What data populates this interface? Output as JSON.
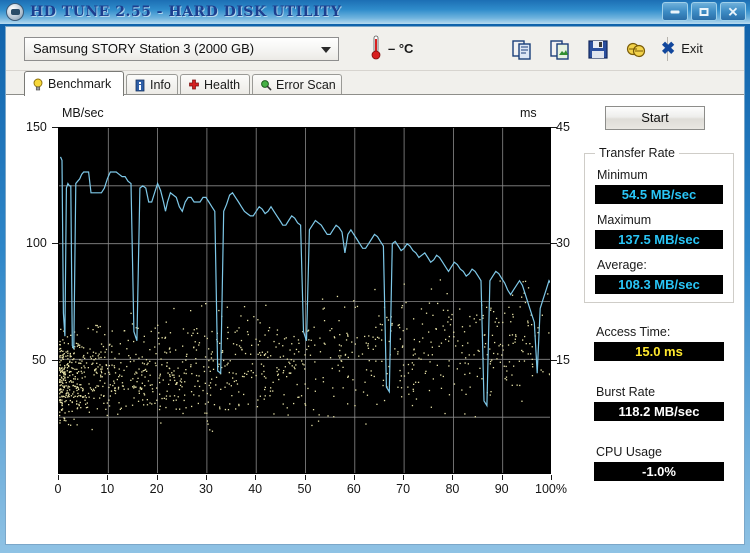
{
  "window": {
    "title": "HD TUNE 2.55 - HARD DISK UTILITY",
    "icon": "disk-icon",
    "minimize": "–",
    "maximize": "□",
    "close": "✕"
  },
  "toolbar": {
    "drive": "Samsung STORY Station 3 (2000 GB)",
    "temperature": "– °C",
    "thermometer_icon": "thermometer-icon",
    "icons": [
      {
        "name": "copy-icon"
      },
      {
        "name": "copy-image-icon"
      },
      {
        "name": "save-icon"
      },
      {
        "name": "globe-icon"
      }
    ],
    "exit_mark": "✖",
    "exit_label": "Exit"
  },
  "tabs": [
    {
      "label": "Benchmark",
      "icon": "bulb-icon",
      "active": true
    },
    {
      "label": "Info",
      "icon": "info-icon",
      "active": false
    },
    {
      "label": "Health",
      "icon": "health-cross-icon",
      "active": false
    },
    {
      "label": "Error Scan",
      "icon": "magnifier-icon",
      "active": false
    }
  ],
  "side": {
    "start_label": "Start",
    "transfer_rate_title": "Transfer Rate",
    "minimum_label": "Minimum",
    "minimum_value": "54.5 MB/sec",
    "maximum_label": "Maximum",
    "maximum_value": "137.5 MB/sec",
    "average_label": "Average:",
    "average_value": "108.3 MB/sec",
    "access_time_label": "Access Time:",
    "access_time_value": "15.0 ms",
    "burst_rate_label": "Burst Rate",
    "burst_rate_value": "118.2 MB/sec",
    "cpu_usage_label": "CPU Usage",
    "cpu_usage_value": "-1.0%"
  },
  "colors": {
    "transfer_curve": "#7ec8e8",
    "access_dots": "#e8e3a8",
    "value_cyan": "#29c5f6",
    "value_yellow": "#ffe82e",
    "title_blue": "#1c3f8f"
  },
  "chart_data": {
    "type": "line",
    "title": "",
    "ylabel": "MB/sec",
    "ylabel_right": "ms",
    "xlabel": "100%",
    "xlim": [
      0,
      100
    ],
    "ylim": [
      0,
      150
    ],
    "ylim_right": [
      0,
      45
    ],
    "grid": true,
    "xticks": [
      0,
      10,
      20,
      30,
      40,
      50,
      60,
      70,
      80,
      90,
      100
    ],
    "xticklabels": [
      "0",
      "10",
      "20",
      "30",
      "40",
      "50",
      "60",
      "70",
      "80",
      "90",
      "100%"
    ],
    "yticks": [
      50,
      100,
      150
    ],
    "yticklabels": [
      "50",
      "100",
      "150"
    ],
    "yticks_right": [
      15,
      30,
      45
    ],
    "yticklabels_right": [
      "15",
      "30",
      "45"
    ],
    "series": [
      {
        "name": "Transfer rate",
        "unit": "MB/sec",
        "color": "#7ec8e8",
        "x": [
          0.3,
          0.6,
          0.9,
          1.2,
          1.5,
          1.8,
          2.1,
          2.4,
          2.7,
          3.0,
          3.4,
          3.8,
          4.2,
          4.6,
          5.0,
          5.5,
          6.0,
          6.5,
          7.0,
          7.5,
          8.0,
          8.6,
          9.2,
          9.8,
          10.4,
          11.0,
          11.6,
          12.2,
          12.8,
          13.4,
          14.0,
          14.6,
          15.2,
          15.8,
          16.4,
          17.0,
          17.6,
          18.2,
          18.8,
          19.4,
          20.0,
          20.6,
          21.2,
          21.6,
          22.0,
          22.6,
          23.2,
          23.8,
          24.4,
          25.0,
          25.6,
          26.2,
          26.8,
          27.4,
          28.0,
          28.6,
          29.2,
          29.8,
          30.4,
          31.0,
          31.6,
          32.2,
          32.8,
          33.4,
          34.0,
          34.6,
          35.2,
          35.8,
          36.4,
          37.0,
          37.6,
          38.2,
          38.8,
          39.4,
          40.0,
          40.6,
          41.2,
          41.8,
          42.4,
          43.0,
          43.6,
          44.2,
          44.8,
          45.4,
          46.0,
          46.6,
          47.2,
          47.8,
          48.4,
          49.0,
          49.6,
          50.2,
          50.8,
          51.4,
          52.0,
          52.6,
          53.2,
          53.8,
          54.4,
          55.0,
          55.6,
          56.2,
          56.8,
          57.4,
          58.0,
          58.6,
          59.2,
          59.8,
          60.4,
          61.0,
          61.6,
          62.2,
          62.8,
          63.4,
          64.0,
          64.6,
          65.2,
          65.8,
          66.4,
          67.0,
          67.6,
          68.2,
          68.8,
          69.4,
          70.0,
          70.6,
          71.2,
          71.8,
          72.4,
          73.0,
          73.6,
          74.2,
          74.8,
          75.4,
          76.0,
          76.6,
          77.2,
          77.8,
          78.4,
          79.0,
          79.6,
          80.2,
          80.8,
          81.4,
          82.0,
          82.6,
          83.2,
          83.8,
          84.4,
          85.0,
          85.6,
          86.2,
          86.8,
          87.4,
          88.0,
          88.6,
          89.2,
          89.8,
          90.4,
          91.0,
          91.6,
          92.2,
          92.8,
          93.4,
          94.0,
          94.6,
          95.2,
          95.8,
          96.4,
          97.0,
          97.6,
          98.2,
          98.8,
          99.4,
          100.0
        ],
        "y": [
          137.5,
          136.0,
          70.0,
          60.0,
          124.0,
          126.0,
          125.0,
          125.0,
          56.0,
          54.5,
          126.0,
          127.0,
          128.0,
          130.0,
          131.0,
          131.0,
          131.0,
          122.0,
          122.0,
          122.0,
          122.0,
          122.0,
          124.0,
          128.0,
          131.0,
          131.0,
          131.0,
          130.0,
          129.0,
          129.0,
          127.0,
          126.0,
          62.0,
          58.0,
          124.0,
          125.0,
          124.0,
          118.0,
          118.0,
          122.0,
          126.0,
          123.0,
          118.0,
          114.0,
          118.0,
          122.0,
          121.0,
          120.0,
          116.0,
          114.0,
          118.0,
          120.0,
          120.0,
          118.0,
          118.0,
          118.0,
          120.0,
          120.0,
          118.0,
          116.0,
          114.0,
          45.0,
          44.0,
          114.0,
          117.0,
          121.0,
          122.0,
          120.0,
          118.0,
          116.0,
          114.0,
          113.0,
          112.0,
          112.0,
          114.0,
          116.0,
          115.0,
          113.0,
          114.0,
          116.0,
          114.0,
          112.0,
          110.0,
          108.0,
          108.0,
          110.0,
          112.0,
          111.0,
          109.0,
          108.0,
          62.0,
          58.0,
          106.0,
          108.0,
          110.0,
          109.0,
          108.0,
          106.0,
          104.0,
          104.0,
          106.0,
          108.0,
          107.0,
          105.0,
          96.0,
          104.0,
          106.0,
          104.0,
          102.0,
          100.0,
          98.0,
          98.0,
          100.0,
          102.0,
          104.0,
          103.0,
          101.0,
          99.0,
          38.0,
          36.0,
          100.0,
          101.0,
          99.0,
          97.0,
          98.0,
          100.0,
          99.0,
          97.0,
          96.0,
          94.0,
          95.0,
          96.0,
          94.0,
          92.0,
          93.0,
          95.0,
          94.0,
          92.0,
          90.0,
          88.0,
          90.0,
          92.0,
          91.0,
          89.0,
          88.0,
          86.0,
          87.0,
          89.0,
          88.0,
          86.0,
          84.0,
          32.0,
          30.0,
          84.0,
          86.0,
          88.0,
          87.0,
          85.0,
          83.0,
          80.0,
          78.0,
          80.0,
          82.0,
          84.0,
          82.0,
          78.0,
          74.0,
          70.0,
          66.0,
          44.0,
          72.0,
          76.0,
          80.0,
          84.0,
          82.0,
          76.0
        ]
      },
      {
        "name": "Access time",
        "unit": "ms",
        "type": "scatter",
        "color": "#e8e3a8",
        "note": "scattered points mostly 8–24 ms, densest at left, rising trend across the disk",
        "average_ms": 15.0
      }
    ]
  }
}
